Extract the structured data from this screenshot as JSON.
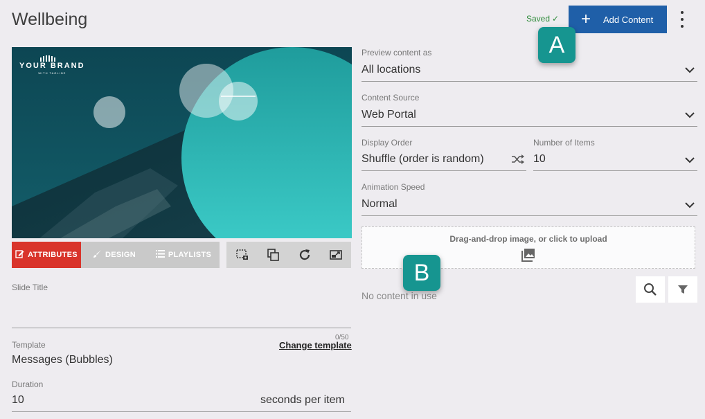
{
  "header": {
    "title": "Wellbeing",
    "saved_label": "Saved",
    "add_label": "Add Content"
  },
  "badges": {
    "a": "A",
    "b": "B"
  },
  "preview": {
    "brand_name": "YOUR BRAND",
    "brand_tag": "WITH TAGLINE"
  },
  "tabs": [
    {
      "label": "ATTRIBUTES",
      "icon": "edit-icon",
      "active": true
    },
    {
      "label": "DESIGN",
      "icon": "brush-icon",
      "active": false
    },
    {
      "label": "PLAYLISTS",
      "icon": "list-icon",
      "active": false
    }
  ],
  "toolbar": [
    "screenshot-crop-icon",
    "duplicate-icon",
    "refresh-icon",
    "external-preview-icon"
  ],
  "left_form": {
    "slide_title_label": "Slide Title",
    "slide_title_value": "",
    "counter": "0/50",
    "template_label": "Template",
    "template_value": "Messages (Bubbles)",
    "change_template": "Change template",
    "duration_label": "Duration",
    "duration_value": "10",
    "duration_unit": "seconds per item"
  },
  "right_form": {
    "preview_as_label": "Preview content as",
    "preview_as_value": "All locations",
    "source_label": "Content Source",
    "source_value": "Web Portal",
    "order_label": "Display Order",
    "order_value": "Shuffle (order is random)",
    "items_label": "Number of Items",
    "items_value": "10",
    "speed_label": "Animation Speed",
    "speed_value": "Normal"
  },
  "upload": {
    "text": "Drag-and-drop image, or click to upload"
  },
  "content": {
    "empty_text": "No content in use"
  },
  "colors": {
    "accent": "#1f5fa8",
    "active_tab": "#d9342b",
    "badge": "#169590",
    "saved": "#2e8b3a"
  }
}
